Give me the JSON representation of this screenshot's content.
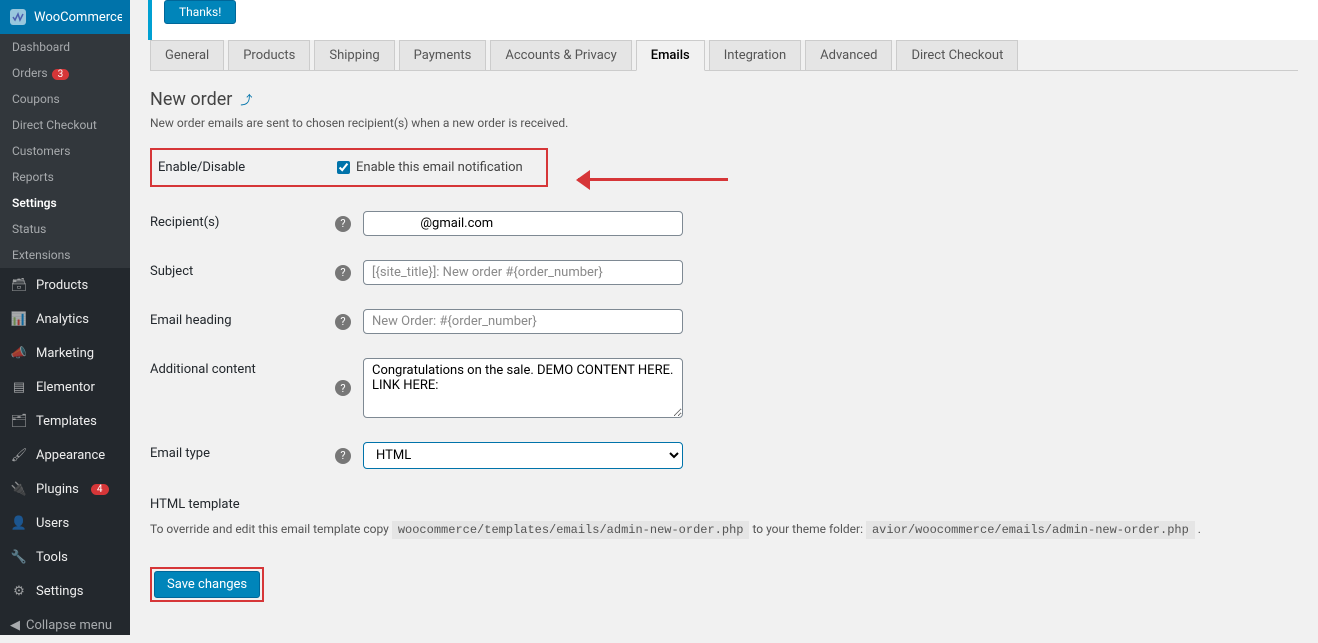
{
  "sidebar": {
    "active_label": "WooCommerce",
    "sub": [
      {
        "label": "Dashboard"
      },
      {
        "label": "Orders",
        "badge": "3"
      },
      {
        "label": "Coupons"
      },
      {
        "label": "Direct Checkout"
      },
      {
        "label": "Customers"
      },
      {
        "label": "Reports"
      },
      {
        "label": "Settings",
        "current": true
      },
      {
        "label": "Status"
      },
      {
        "label": "Extensions"
      }
    ],
    "main": [
      {
        "label": "Products"
      },
      {
        "label": "Analytics"
      },
      {
        "label": "Marketing"
      },
      {
        "label": "Elementor"
      },
      {
        "label": "Templates"
      },
      {
        "label": "Appearance"
      },
      {
        "label": "Plugins",
        "badge": "4"
      },
      {
        "label": "Users"
      },
      {
        "label": "Tools"
      },
      {
        "label": "Settings"
      }
    ],
    "collapse": "Collapse menu"
  },
  "notice": {
    "thanks": "Thanks!"
  },
  "tabs": [
    "General",
    "Products",
    "Shipping",
    "Payments",
    "Accounts & Privacy",
    "Emails",
    "Integration",
    "Advanced",
    "Direct Checkout"
  ],
  "active_tab": "Emails",
  "page": {
    "title": "New order",
    "back": "⤴",
    "desc": "New order emails are sent to chosen recipient(s) when a new order is received."
  },
  "form": {
    "enable_label": "Enable/Disable",
    "enable_checkbox": "Enable this email notification",
    "recipients_label": "Recipient(s)",
    "recipients_value": "               @gmail.com",
    "subject_label": "Subject",
    "subject_placeholder": "[{site_title}]: New order #{order_number}",
    "heading_label": "Email heading",
    "heading_placeholder": "New Order: #{order_number}",
    "additional_label": "Additional content",
    "additional_value": "Congratulations on the sale. DEMO CONTENT HERE. LINK HERE:",
    "type_label": "Email type",
    "type_value": "HTML",
    "template_label": "HTML template",
    "template_desc_1": "To override and edit this email template copy ",
    "template_code_1": "woocommerce/templates/emails/admin-new-order.php",
    "template_desc_2": " to your theme folder: ",
    "template_code_2": "avior/woocommerce/emails/admin-new-order.php",
    "template_desc_3": " .",
    "save": "Save changes"
  }
}
